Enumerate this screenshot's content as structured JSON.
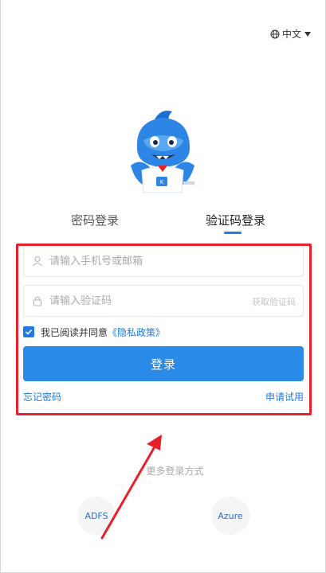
{
  "header": {
    "language_label": "中文"
  },
  "tabs": [
    {
      "label": "密码登录",
      "active": false
    },
    {
      "label": "验证码登录",
      "active": true
    }
  ],
  "form": {
    "account_placeholder": "请输入手机号或邮箱",
    "code_placeholder": "请输入验证码",
    "get_code_label": "获取验证码",
    "agree_text": "我已阅读并同意",
    "privacy_link": "《隐私政策》",
    "agree_checked": true,
    "login_button": "登录",
    "forgot_password": "忘记密码",
    "apply_trial": "申请试用"
  },
  "alt_login": {
    "title": "更多登录方式",
    "options": [
      {
        "label": "ADFS"
      },
      {
        "label": "Azure"
      }
    ]
  },
  "colors": {
    "accent": "#2a8ae8",
    "link": "#1e7be6",
    "highlight": "#e8202a"
  }
}
